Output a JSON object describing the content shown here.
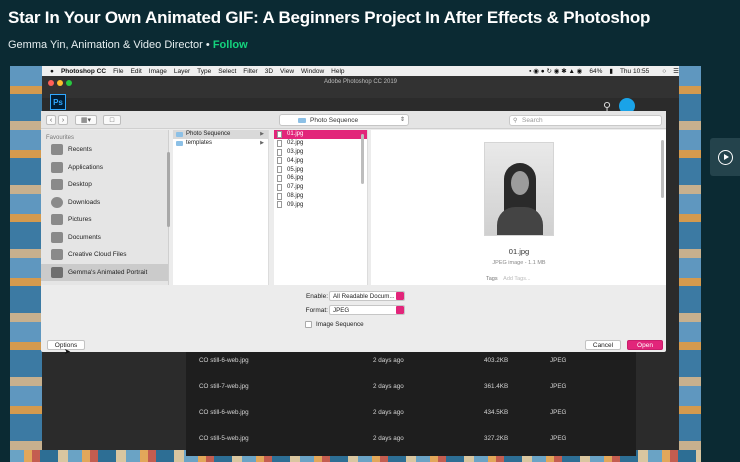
{
  "course": {
    "title": "Star In Your Own Animated GIF: A Beginners Project In After Effects & Photoshop",
    "author": "Gemma Yin, Animation & Video Director",
    "separator": "•",
    "follow_label": "Follow"
  },
  "mac_menubar": {
    "apple": "",
    "app_name": "Photoshop CC",
    "menus": [
      "File",
      "Edit",
      "Image",
      "Layer",
      "Type",
      "Select",
      "Filter",
      "3D",
      "View",
      "Window",
      "Help"
    ],
    "battery": "64%",
    "clock": "Thu 10:55"
  },
  "ps_window": {
    "title": "Adobe Photoshop CC 2019",
    "logo": "Ps"
  },
  "dialog": {
    "location": "Photo Sequence",
    "search_placeholder": "Search",
    "sidebar_heading": "Favourites",
    "sidebar_items": [
      {
        "label": "Recents",
        "icon": "recents-icon"
      },
      {
        "label": "Applications",
        "icon": "applications-icon"
      },
      {
        "label": "Desktop",
        "icon": "desktop-icon"
      },
      {
        "label": "Downloads",
        "icon": "downloads-icon"
      },
      {
        "label": "Pictures",
        "icon": "pictures-icon"
      },
      {
        "label": "Documents",
        "icon": "documents-icon"
      },
      {
        "label": "Creative Cloud Files",
        "icon": "creative-cloud-icon"
      },
      {
        "label": "Gemma's Animated Portrait",
        "icon": "folder-icon",
        "selected": true
      }
    ],
    "folders": [
      {
        "label": "Photo Sequence",
        "selected": true
      },
      {
        "label": "templates",
        "selected": false
      }
    ],
    "files": [
      "01.jpg",
      "02.jpg",
      "03.jpg",
      "04.jpg",
      "05.jpg",
      "06.jpg",
      "07.jpg",
      "08.jpg",
      "09.jpg"
    ],
    "selected_file_index": 0,
    "preview": {
      "name": "01.jpg",
      "meta": "JPEG image - 1.1 MB",
      "tags_label": "Tags",
      "tags_placeholder": "Add Tags..."
    },
    "enable_label": "Enable:",
    "enable_value": "All Readable Docum...",
    "format_label": "Format:",
    "format_value": "JPEG",
    "image_sequence_label": "Image Sequence",
    "image_sequence_checked": false,
    "options_label": "Options",
    "cancel_label": "Cancel",
    "open_label": "Open"
  },
  "background_files": [
    {
      "name": "CO still-6-web.jpg",
      "date": "2 days ago",
      "size": "403.2KB",
      "type": "JPEG"
    },
    {
      "name": "CO still-7-web.jpg",
      "date": "2 days ago",
      "size": "361.4KB",
      "type": "JPEG"
    },
    {
      "name": "CO still-6-web.jpg",
      "date": "2 days ago",
      "size": "434.5KB",
      "type": "JPEG"
    },
    {
      "name": "CO still-5-web.jpg",
      "date": "2 days ago",
      "size": "327.2KB",
      "type": "JPEG"
    }
  ],
  "colors": {
    "accent_pink": "#e2257a",
    "follow_green": "#14d37d",
    "page_bg": "#0b2a33"
  }
}
